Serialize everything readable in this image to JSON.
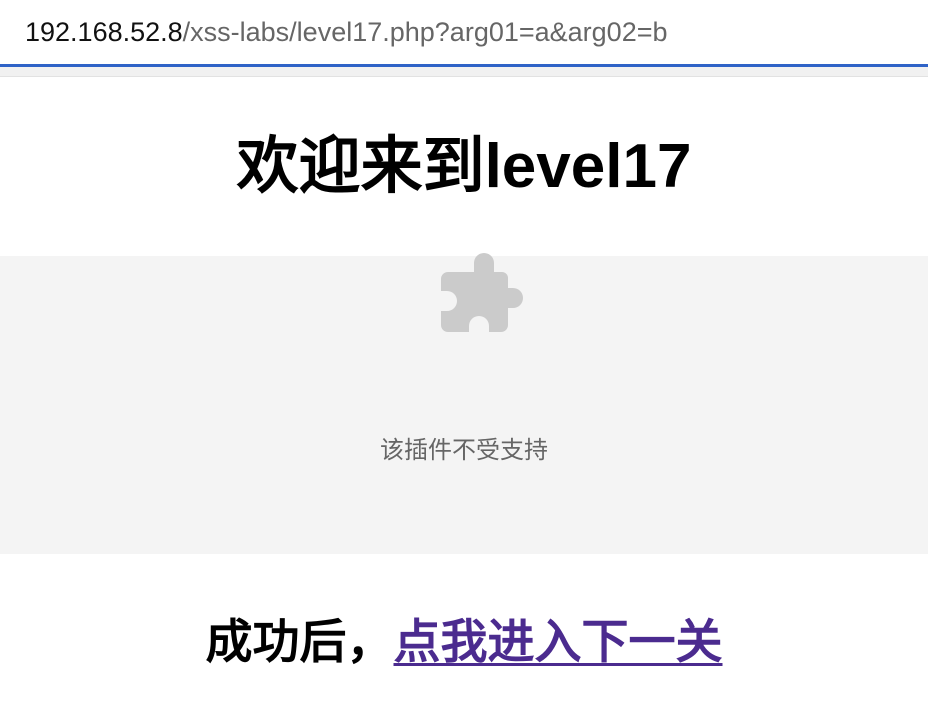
{
  "browser": {
    "url_host": "192.168.52.8",
    "url_rest": "/xss-labs/level17.php?arg01=a&arg02=b"
  },
  "page": {
    "title": "欢迎来到level17",
    "plugin": {
      "icon": "puzzle-piece-icon",
      "message": "该插件不受支持"
    },
    "success": {
      "prefix": "成功后，",
      "link_text": "点我进入下一关"
    }
  },
  "colors": {
    "address_accent": "#2f63c7",
    "plugin_background": "#f4f4f4",
    "plugin_icon": "#cbcbcb",
    "link": "#4b2b8f"
  }
}
